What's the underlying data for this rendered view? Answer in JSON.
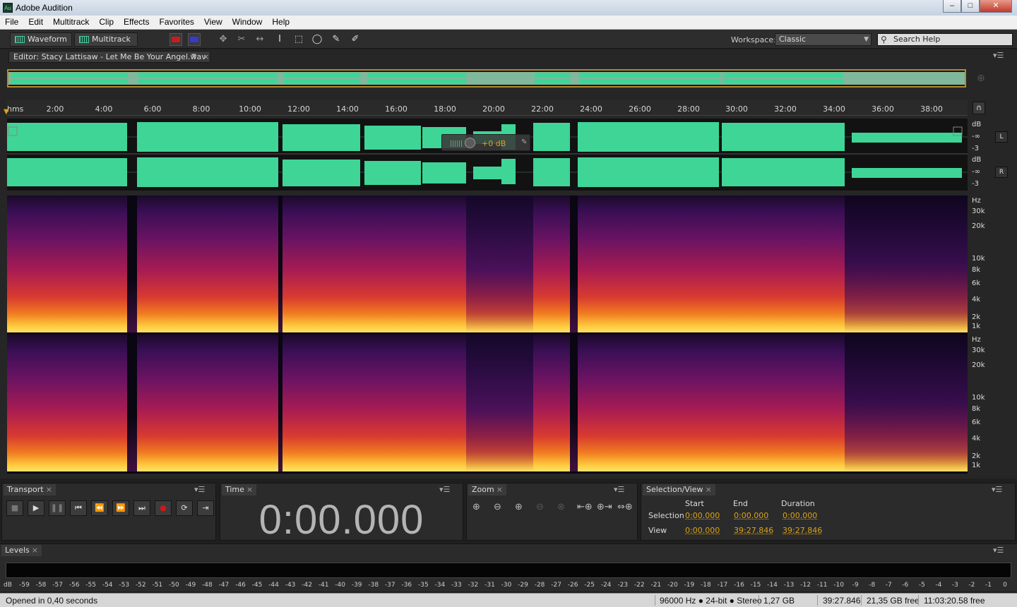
{
  "window": {
    "app_icon": "Au",
    "title": "Adobe Audition",
    "controls": {
      "minimize": "–",
      "maximize": "□",
      "close": "✕"
    }
  },
  "menu": [
    "File",
    "Edit",
    "Multitrack",
    "Clip",
    "Effects",
    "Favorites",
    "View",
    "Window",
    "Help"
  ],
  "toolbar": {
    "waveform_label": "Waveform",
    "multitrack_label": "Multitrack",
    "workspace_label": "Workspace:",
    "workspace_value": "Classic",
    "search_placeholder": "Search Help"
  },
  "editor": {
    "tab_label": "Editor: Stacy Lattisaw - Let Me Be Your Angel.wav",
    "ruler_unit": "hms",
    "ruler_ticks": [
      "2:00",
      "4:00",
      "6:00",
      "8:00",
      "10:00",
      "12:00",
      "14:00",
      "16:00",
      "18:00",
      "20:00",
      "22:00",
      "24:00",
      "26:00",
      "28:00",
      "30:00",
      "32:00",
      "34:00",
      "36:00",
      "38:00"
    ],
    "hud_value": "+0 dB",
    "db_scale": [
      "dB",
      "-∞",
      "-3"
    ],
    "channels": [
      "L",
      "R"
    ],
    "hz_scale": [
      "Hz",
      "30k",
      "20k",
      "10k",
      "8k",
      "6k",
      "4k",
      "2k",
      "1k"
    ]
  },
  "transport": {
    "tab": "Transport",
    "buttons": [
      "stop",
      "play",
      "pause",
      "go-to-start",
      "rewind",
      "fast-forward",
      "go-to-end",
      "record",
      "loop",
      "skip"
    ]
  },
  "time": {
    "tab": "Time",
    "display": "0:00.000"
  },
  "zoom": {
    "tab": "Zoom"
  },
  "selection_view": {
    "tab": "Selection/View",
    "headers": [
      "Start",
      "End",
      "Duration"
    ],
    "rows": [
      {
        "label": "Selection",
        "start": "0:00.000",
        "end": "0:00.000",
        "duration": "0:00.000"
      },
      {
        "label": "View",
        "start": "0:00.000",
        "end": "39:27.846",
        "duration": "39:27.846"
      }
    ]
  },
  "levels": {
    "tab": "Levels",
    "scale": [
      "dB",
      "-59",
      "-58",
      "-57",
      "-56",
      "-55",
      "-54",
      "-53",
      "-52",
      "-51",
      "-50",
      "-49",
      "-48",
      "-47",
      "-46",
      "-45",
      "-44",
      "-43",
      "-42",
      "-41",
      "-40",
      "-39",
      "-38",
      "-37",
      "-36",
      "-35",
      "-34",
      "-33",
      "-32",
      "-31",
      "-30",
      "-29",
      "-28",
      "-27",
      "-26",
      "-25",
      "-24",
      "-23",
      "-22",
      "-21",
      "-20",
      "-19",
      "-18",
      "-17",
      "-16",
      "-15",
      "-14",
      "-13",
      "-12",
      "-11",
      "-10",
      "-9",
      "-8",
      "-7",
      "-6",
      "-5",
      "-4",
      "-3",
      "-2",
      "-1",
      "0"
    ]
  },
  "status": {
    "message": "Opened in 0,40 seconds",
    "format": "96000 Hz ● 24-bit ● Stereo",
    "size": "1,27 GB",
    "duration": "39:27.846",
    "free": "21,35 GB free",
    "free_time": "11:03:20.58 free"
  },
  "colors": {
    "waveform": "#3ed597",
    "accent": "#d9a21b",
    "record": "#d01818"
  }
}
